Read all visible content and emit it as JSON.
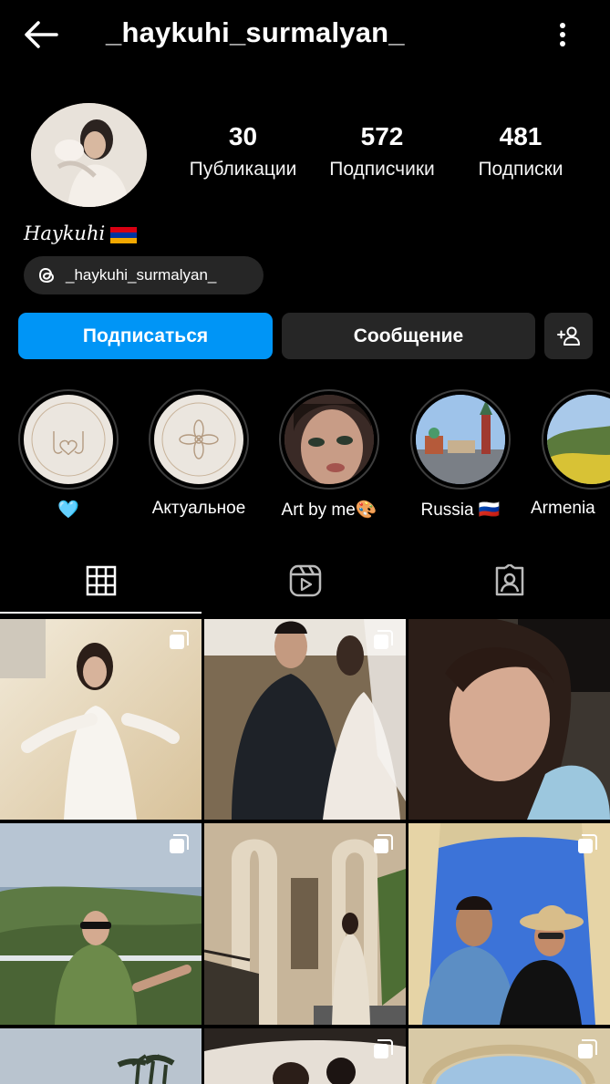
{
  "header": {
    "username": "_haykuhi_surmalyan_",
    "back_icon": "arrow-left-icon",
    "more_icon": "more-vertical-icon"
  },
  "profile": {
    "stats": [
      {
        "value": "30",
        "label": "Публикации"
      },
      {
        "value": "572",
        "label": "Подписчики"
      },
      {
        "value": "481",
        "label": "Подписки"
      }
    ],
    "display_name": "Haykuhi",
    "flag": "armenia-flag",
    "threads_handle": "_haykuhi_surmalyan_"
  },
  "actions": {
    "follow_label": "Подписаться",
    "message_label": "Сообщение",
    "add_friend_icon": "add-person-icon"
  },
  "highlights": [
    {
      "label": "🩵"
    },
    {
      "label": "Актуальное"
    },
    {
      "label": "Art by me🎨"
    },
    {
      "label": "Russia 🇷🇺"
    },
    {
      "label": "Armenia"
    }
  ],
  "tabs": [
    {
      "icon": "grid-icon",
      "active": true
    },
    {
      "icon": "reels-icon",
      "active": false
    },
    {
      "icon": "tagged-icon",
      "active": false
    }
  ],
  "colors": {
    "accent": "#0095f6",
    "button_dark": "#262626",
    "background": "#000000"
  }
}
